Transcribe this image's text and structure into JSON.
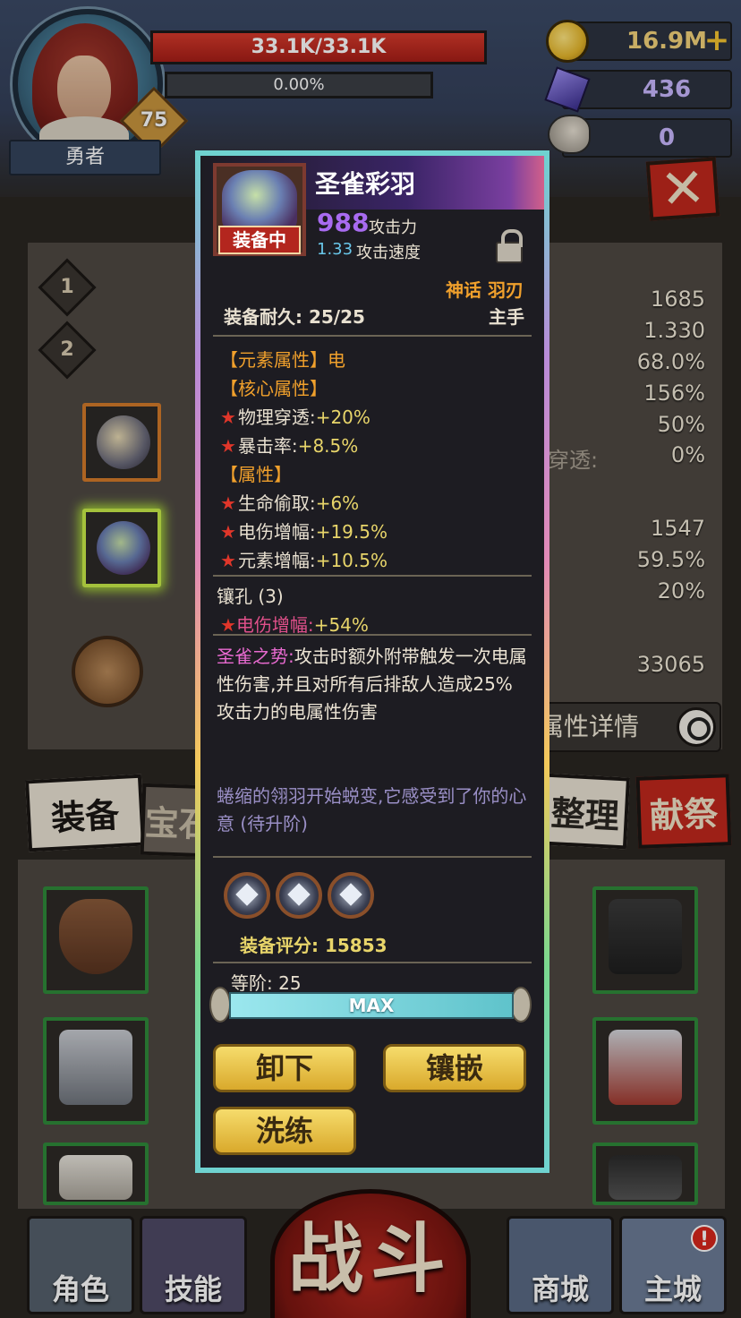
{
  "player": {
    "name": "勇者",
    "level": "75",
    "hp": "33.1K/33.1K",
    "xp": "0.00%"
  },
  "currency": {
    "gold": "16.9M",
    "gems": "436",
    "ram": "0"
  },
  "equip_slots": [
    "1",
    "2"
  ],
  "stats_panel": {
    "values": [
      "1685",
      "1.330",
      "68.0%",
      "156%",
      "50%",
      "0%",
      "1547",
      "59.5%",
      "20%",
      "33065"
    ],
    "visible_label": "穿透:",
    "detail_button": "属性详情"
  },
  "tabs": {
    "equip": "装备",
    "gem": "宝石",
    "sort": "整理",
    "sacrifice": "献祭"
  },
  "item": {
    "name": "圣雀彩羽",
    "equipped_tag": "装备中",
    "attack": "988",
    "attack_label": "攻击力",
    "speed": "1.33",
    "speed_label": "攻击速度",
    "rarity": "神话 羽刃",
    "durability": "装备耐久: 25/25",
    "slot": "主手",
    "element_head": "【元素属性】电",
    "core_head": "【核心属性】",
    "core_stats": [
      {
        "name": "物理穿透:",
        "value": "+20%"
      },
      {
        "name": "暴击率:",
        "value": "+8.5%"
      }
    ],
    "attr_head": "【属性】",
    "attr_stats": [
      {
        "name": "生命偷取:",
        "value": "+6%"
      },
      {
        "name": "电伤增幅:",
        "value": "+19.5%"
      },
      {
        "name": "元素增幅:",
        "value": "+10.5%"
      }
    ],
    "socket_head": "镶孔 (3)",
    "socket_stat_name": "电伤增幅:",
    "socket_stat_value": "+54%",
    "set_name": "圣雀之势:",
    "set_desc": "攻击时额外附带触发一次电属性伤害,并且对所有后排敌人造成25%攻击力的电属性伤害",
    "flavor": "蜷缩的翎羽开始蜕变,它感受到了你的心意 (待升阶)",
    "score": "装备评分: 15853",
    "rank": "等阶: 25",
    "max_label": "MAX",
    "buttons": {
      "unequip": "卸下",
      "inlay": "镶嵌",
      "refine": "洗练"
    }
  },
  "nav": {
    "character": "角色",
    "skills": "技能",
    "battle": "战斗",
    "shop": "商城",
    "main_city": "主城",
    "alert": "!"
  }
}
